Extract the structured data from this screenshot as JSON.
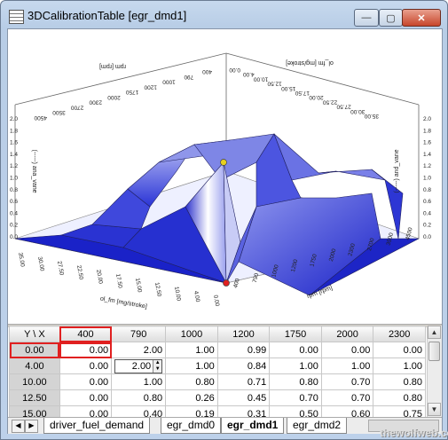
{
  "window": {
    "title": "3DCalibrationTable [egr_dmd1]",
    "buttons": {
      "minimize": "—",
      "maximize": "▢",
      "close": "✕"
    }
  },
  "plot": {
    "back_left_axis_label": "rpm [rpm]",
    "back_left_ticks": [
      "4500",
      "3500",
      "2700",
      "2300",
      "2000",
      "1750",
      "1200",
      "1000",
      "790",
      "400"
    ],
    "back_right_axis_label": "ol_fm [mg/stroke]",
    "back_right_ticks": [
      "0.00",
      "4.00",
      "10.00",
      "12.50",
      "15.00",
      "17.50",
      "20.00",
      "22.50",
      "27.50",
      "30.00",
      "35.00"
    ],
    "left_value_label": "(-----) ana_vane",
    "right_value_label": "(-----) and_vane",
    "value_ticks": [
      "2.0",
      "1.8",
      "1.6",
      "1.4",
      "1.2",
      "1.0",
      "0.8",
      "0.6",
      "0.4",
      "0.2",
      "0.0"
    ],
    "front_left_axis_label": "ol_fm [mg/stroke]",
    "front_left_ticks": [
      "35.00",
      "30.00",
      "27.50",
      "22.50",
      "20.00",
      "17.50",
      "15.00",
      "12.50",
      "10.00",
      "4.00",
      "0.00"
    ],
    "front_right_axis_label": "rpm [rpm]",
    "front_right_ticks": [
      "400",
      "790",
      "1000",
      "1200",
      "1750",
      "2000",
      "2300",
      "2700",
      "3500",
      "4500"
    ],
    "colors": {
      "surface": "#1f2fd8",
      "highlight": "#f2f2ff",
      "marker_selected": "#e8d020",
      "marker_origin": "#e02020"
    }
  },
  "grid": {
    "corner": "Y \\ X",
    "columns": [
      "400",
      "790",
      "1000",
      "1200",
      "1750",
      "2000",
      "2300"
    ],
    "rows": [
      {
        "y": "0.00",
        "cells": [
          "0.00",
          "2.00",
          "1.00",
          "0.99",
          "0.00",
          "0.00",
          "0.00"
        ]
      },
      {
        "y": "4.00",
        "cells": [
          "0.00",
          "2.00",
          "1.00",
          "0.84",
          "1.00",
          "1.00",
          "1.00"
        ]
      },
      {
        "y": "10.00",
        "cells": [
          "0.00",
          "1.00",
          "0.80",
          "0.71",
          "0.80",
          "0.70",
          "0.80"
        ]
      },
      {
        "y": "12.50",
        "cells": [
          "0.00",
          "0.80",
          "0.26",
          "0.45",
          "0.70",
          "0.70",
          "0.80"
        ]
      },
      {
        "y": "15.00",
        "cells": [
          "0.00",
          "0.40",
          "0.19",
          "0.31",
          "0.50",
          "0.60",
          "0.75"
        ]
      }
    ],
    "editing_value": "2.00"
  },
  "tabs": [
    "driver_fuel_demand",
    "egr_dmd0",
    "egr_dmd1",
    "egr_dmd2"
  ],
  "active_tab": "egr_dmd1",
  "watermark": "thewolfweb.com"
}
